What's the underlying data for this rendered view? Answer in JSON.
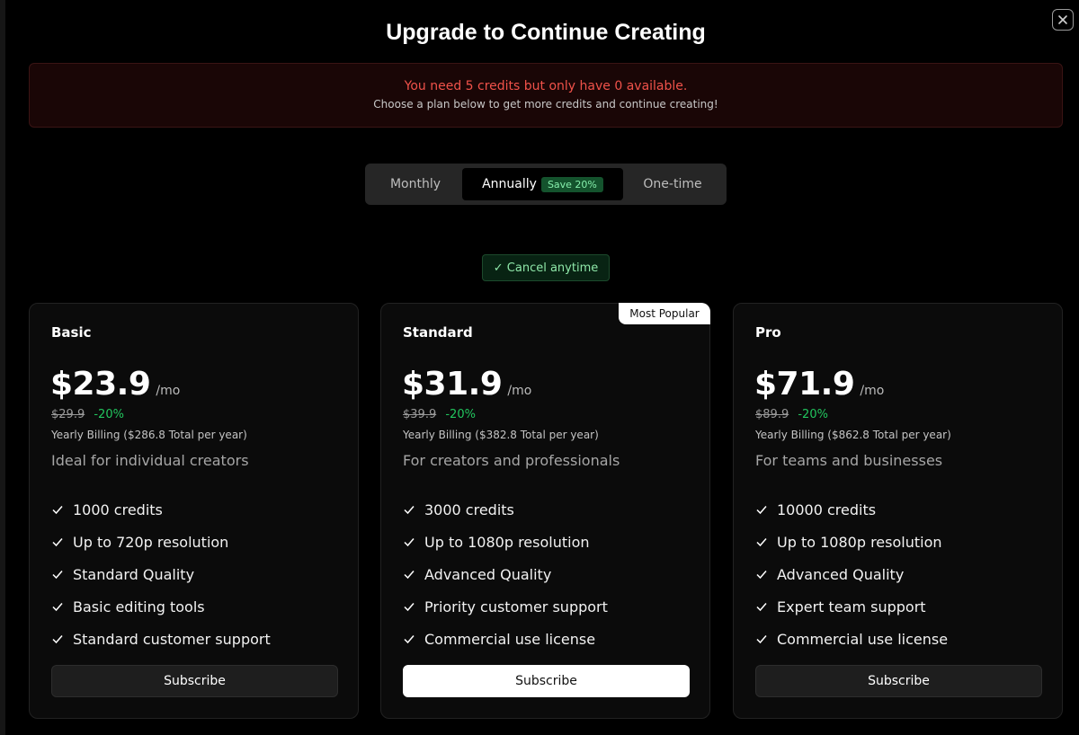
{
  "title": "Upgrade to Continue Creating",
  "alert": {
    "main": "You need 5 credits but only have 0 available.",
    "sub": "Choose a plan below to get more credits and continue creating!"
  },
  "billing": {
    "tabs": [
      "Monthly",
      "Annually",
      "One-time"
    ],
    "selected": "Annually",
    "save_badge": "Save 20%"
  },
  "cancel_note": "✓ Cancel anytime",
  "colors": {
    "accent_green": "#22c55e",
    "alert_red": "#f0524a",
    "background": "#000000"
  },
  "plans": [
    {
      "name": "Basic",
      "price": "$23.9",
      "per": "/mo",
      "old_price": "$29.9",
      "discount": "-20%",
      "billing_note": "Yearly Billing ($286.8 Total per year)",
      "tagline": "Ideal for individual creators",
      "features": [
        "1000 credits",
        "Up to 720p resolution",
        "Standard Quality",
        "Basic editing tools",
        "Standard customer support"
      ],
      "cta": "Subscribe"
    },
    {
      "name": "Standard",
      "badge": "Most Popular",
      "price": "$31.9",
      "per": "/mo",
      "old_price": "$39.9",
      "discount": "-20%",
      "billing_note": "Yearly Billing ($382.8 Total per year)",
      "tagline": "For creators and professionals",
      "features": [
        "3000 credits",
        "Up to 1080p resolution",
        "Advanced Quality",
        "Priority customer support",
        "Commercial use license"
      ],
      "cta": "Subscribe"
    },
    {
      "name": "Pro",
      "price": "$71.9",
      "per": "/mo",
      "old_price": "$89.9",
      "discount": "-20%",
      "billing_note": "Yearly Billing ($862.8 Total per year)",
      "tagline": "For teams and businesses",
      "features": [
        "10000 credits",
        "Up to 1080p resolution",
        "Advanced Quality",
        "Expert team support",
        "Commercial use license"
      ],
      "cta": "Subscribe"
    }
  ]
}
